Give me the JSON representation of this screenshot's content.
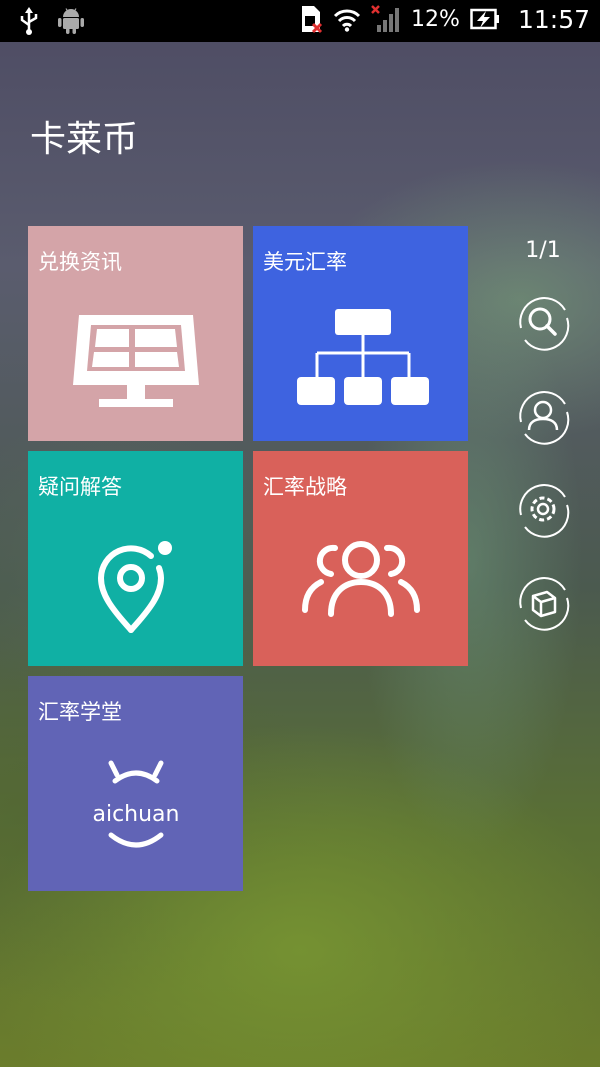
{
  "status_bar": {
    "battery_percent": "12%",
    "time": "11:57"
  },
  "app": {
    "title": "卡莱币"
  },
  "tiles": [
    {
      "label": "兑换资讯",
      "icon": "solar-panel-icon",
      "color": "#d4a4a8"
    },
    {
      "label": "美元汇率",
      "icon": "org-chart-icon",
      "color": "#3e63e0"
    },
    {
      "label": "疑问解答",
      "icon": "location-pin-icon",
      "color": "#10b0a4"
    },
    {
      "label": "汇率战略",
      "icon": "users-group-icon",
      "color": "#d9615a"
    },
    {
      "label": "汇率学堂",
      "icon": "aichuan-logo-icon",
      "color": "#6164b6"
    }
  ],
  "logo_text": "aichuan",
  "page_indicator": "1/1",
  "side_buttons": [
    {
      "icon": "search-icon"
    },
    {
      "icon": "user-icon"
    },
    {
      "icon": "settings-icon"
    },
    {
      "icon": "cube-icon"
    }
  ]
}
